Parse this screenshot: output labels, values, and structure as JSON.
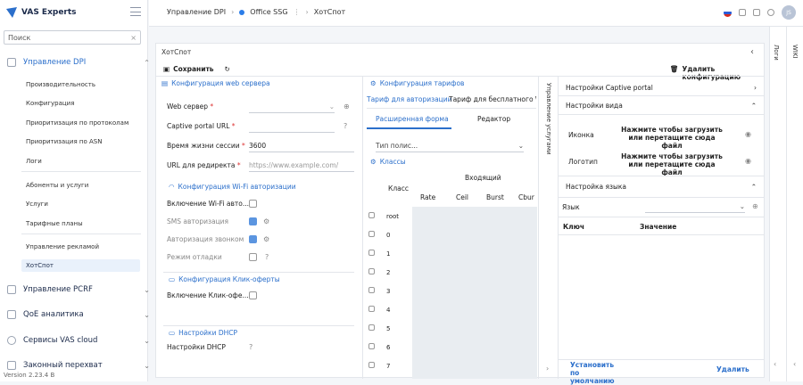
{
  "sidebar": {
    "brand": "VAS Experts",
    "search_placeholder": "Поиск",
    "groups": [
      {
        "label": "Управление DPI",
        "expanded": true
      },
      {
        "label": "Управление PCRF"
      },
      {
        "label": "QoE аналитика"
      },
      {
        "label": "Сервисы VAS cloud"
      },
      {
        "label": "Законный перехват"
      }
    ],
    "items": [
      "Производительность",
      "Конфигурация",
      "Приоритизация по протоколам",
      "Приоритизация по ASN",
      "Логи",
      "Абоненты и услуги",
      "Услуги",
      "Тарифные планы",
      "Управление рекламой",
      "ХотСпот"
    ],
    "version": "Version 2.23.4 B"
  },
  "topbar": {
    "crumb1": "Управление DPI",
    "crumb2": "Office SSG",
    "crumb3": "ХотСпот",
    "avatar": "JS"
  },
  "main": {
    "title": "ХотСпот",
    "save": "Сохранить",
    "delete_config": "Удалить конфигурацию",
    "wiki": "WIKI",
    "logs": "Логи",
    "web": {
      "head": "Конфигурация web сервера",
      "server": "Web сервер",
      "captive": "Captive portal URL",
      "session": "Время жизни сессии",
      "session_val": "3600",
      "redirect": "URL для редиректа",
      "redirect_ph": "https://www.example.com/"
    },
    "wifi": {
      "head": "Конфигурация Wi-Fi авторизации",
      "enable": "Включение Wi-Fi авто...",
      "sms": "SMS авторизация",
      "call": "Авторизация звонком",
      "debug": "Режим отладки"
    },
    "click": {
      "head": "Конфигурация Клик-оферты",
      "enable": "Включение Клик-офе..."
    },
    "dhcp": {
      "head": "Настройки DHCP",
      "label": "Настройки DHCP"
    },
    "tariff": {
      "head": "Конфигурация тарифов",
      "tab1": "Тариф для авторизации",
      "tab2": "Тариф для бесплатного W",
      "sub1": "Расширенная форма",
      "sub2": "Редактор",
      "policy": "Тип полис...",
      "classes": "Классы",
      "col_class": "Класс",
      "col_in": "Входящий",
      "cols": [
        "Rate",
        "Ceil",
        "Burst",
        "Cbur"
      ],
      "rows": [
        "root",
        "0",
        "1",
        "2",
        "3",
        "4",
        "5",
        "6",
        "7"
      ]
    },
    "services_vertical": "Управление услугами",
    "captive": {
      "settings": "Настройки Captive portal",
      "view": "Настройки вида",
      "icon": "Иконка",
      "logo": "Логотип",
      "upload": "Нажмите чтобы загрузить или перетащите сюда файл",
      "lang_settings": "Настройка языка",
      "lang": "Язык",
      "key": "Ключ",
      "value": "Значение",
      "set_default": "Установить по умолчанию",
      "delete": "Удалить"
    }
  }
}
